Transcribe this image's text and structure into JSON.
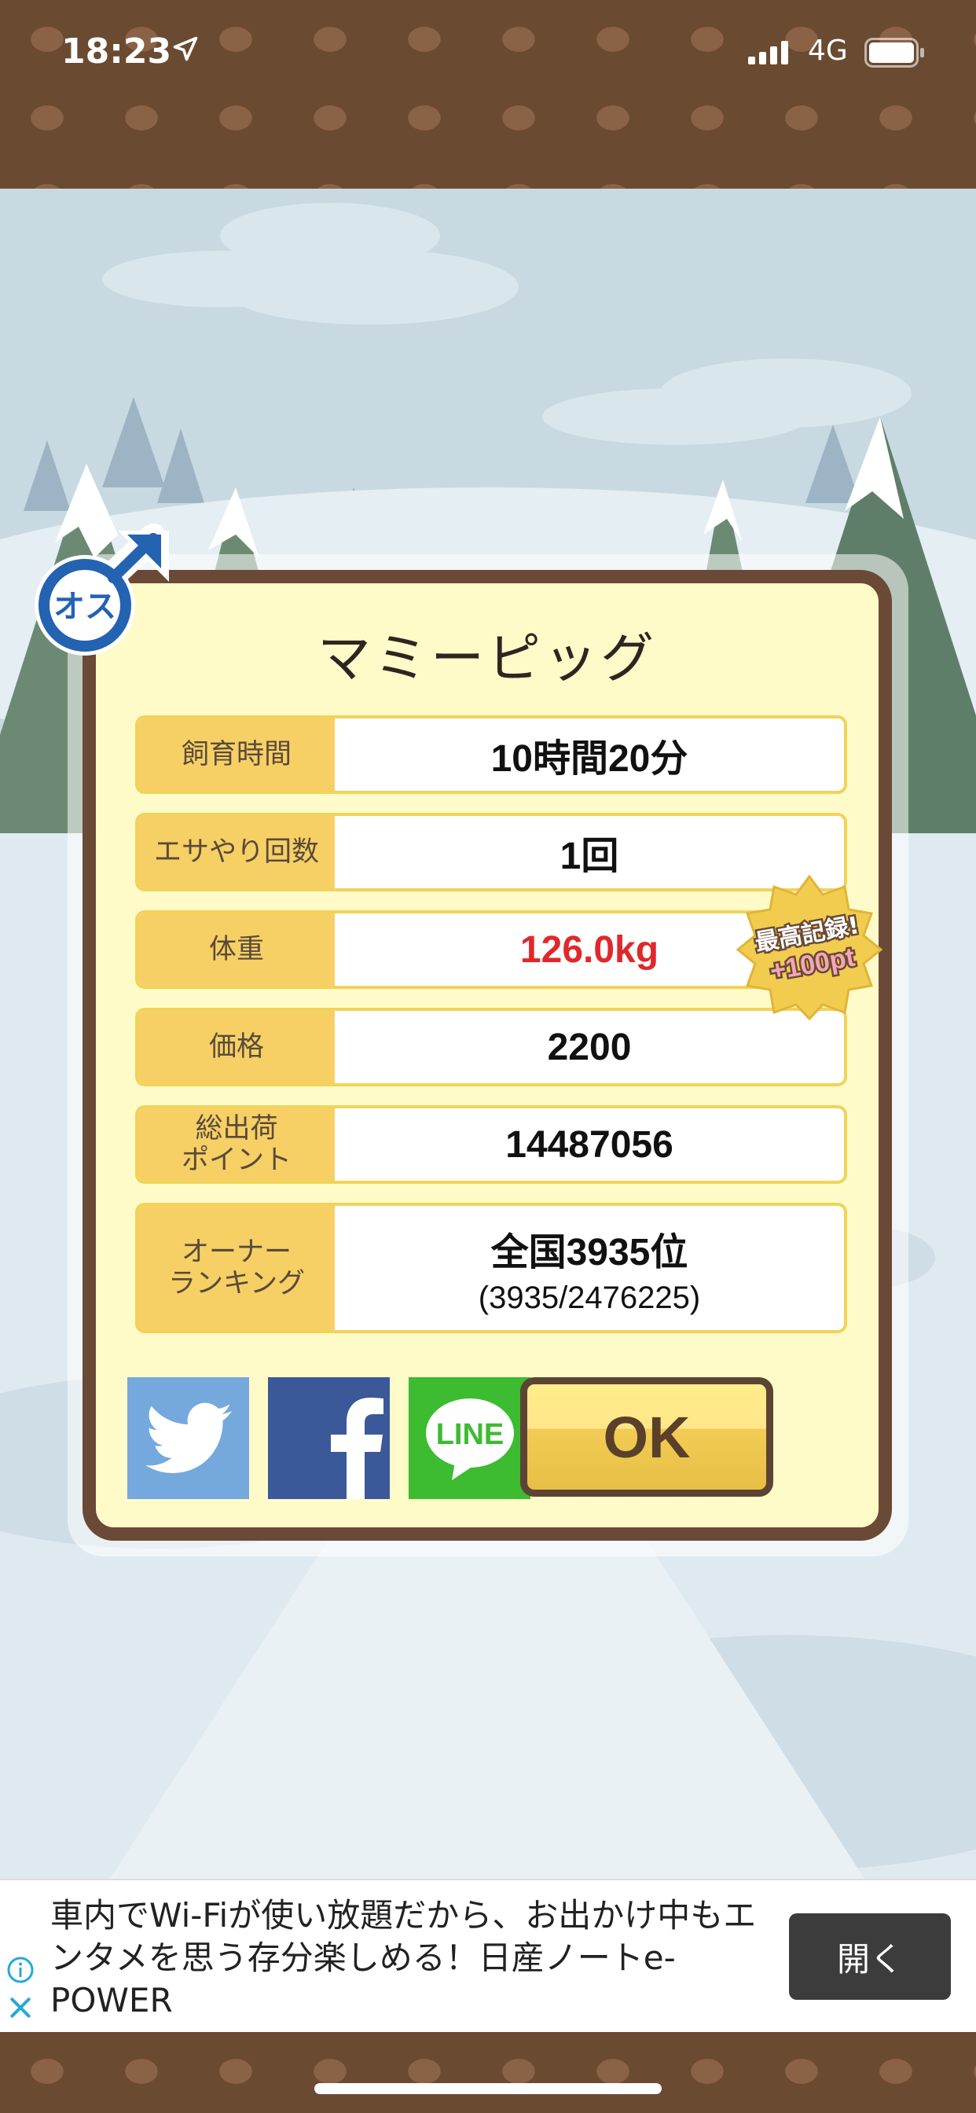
{
  "status": {
    "time": "18:23",
    "network": "4G"
  },
  "card": {
    "gender_label": "オス",
    "title": "マミーピッグ",
    "rows": [
      {
        "label": "飼育時間",
        "value": "10時間20分"
      },
      {
        "label": "エサやり回数",
        "value": "1回"
      },
      {
        "label": "体重",
        "value": "126.0kg"
      },
      {
        "label": "価格",
        "value": "2200"
      },
      {
        "label": "総出荷\nポイント",
        "value": "14487056"
      },
      {
        "label": "オーナー\nランキング",
        "value": "全国3935位",
        "sub": "(3935/2476225)"
      }
    ],
    "badge": {
      "line1": "最高記録!",
      "line2": "+100pt"
    },
    "social": [
      {
        "name": "twitter",
        "color": "#75a8dd"
      },
      {
        "name": "facebook",
        "color": "#3b5998"
      },
      {
        "name": "line",
        "label": "LINE",
        "color": "#3dbb31"
      }
    ],
    "ok_label": "OK",
    "weight_color": "#e0282b"
  },
  "ad": {
    "text": "車内でWi-Fiが使い放題だから、お出かけ中もエンタメを思う存分楽しめる！日産ノートe-POWER",
    "button": "開く"
  }
}
